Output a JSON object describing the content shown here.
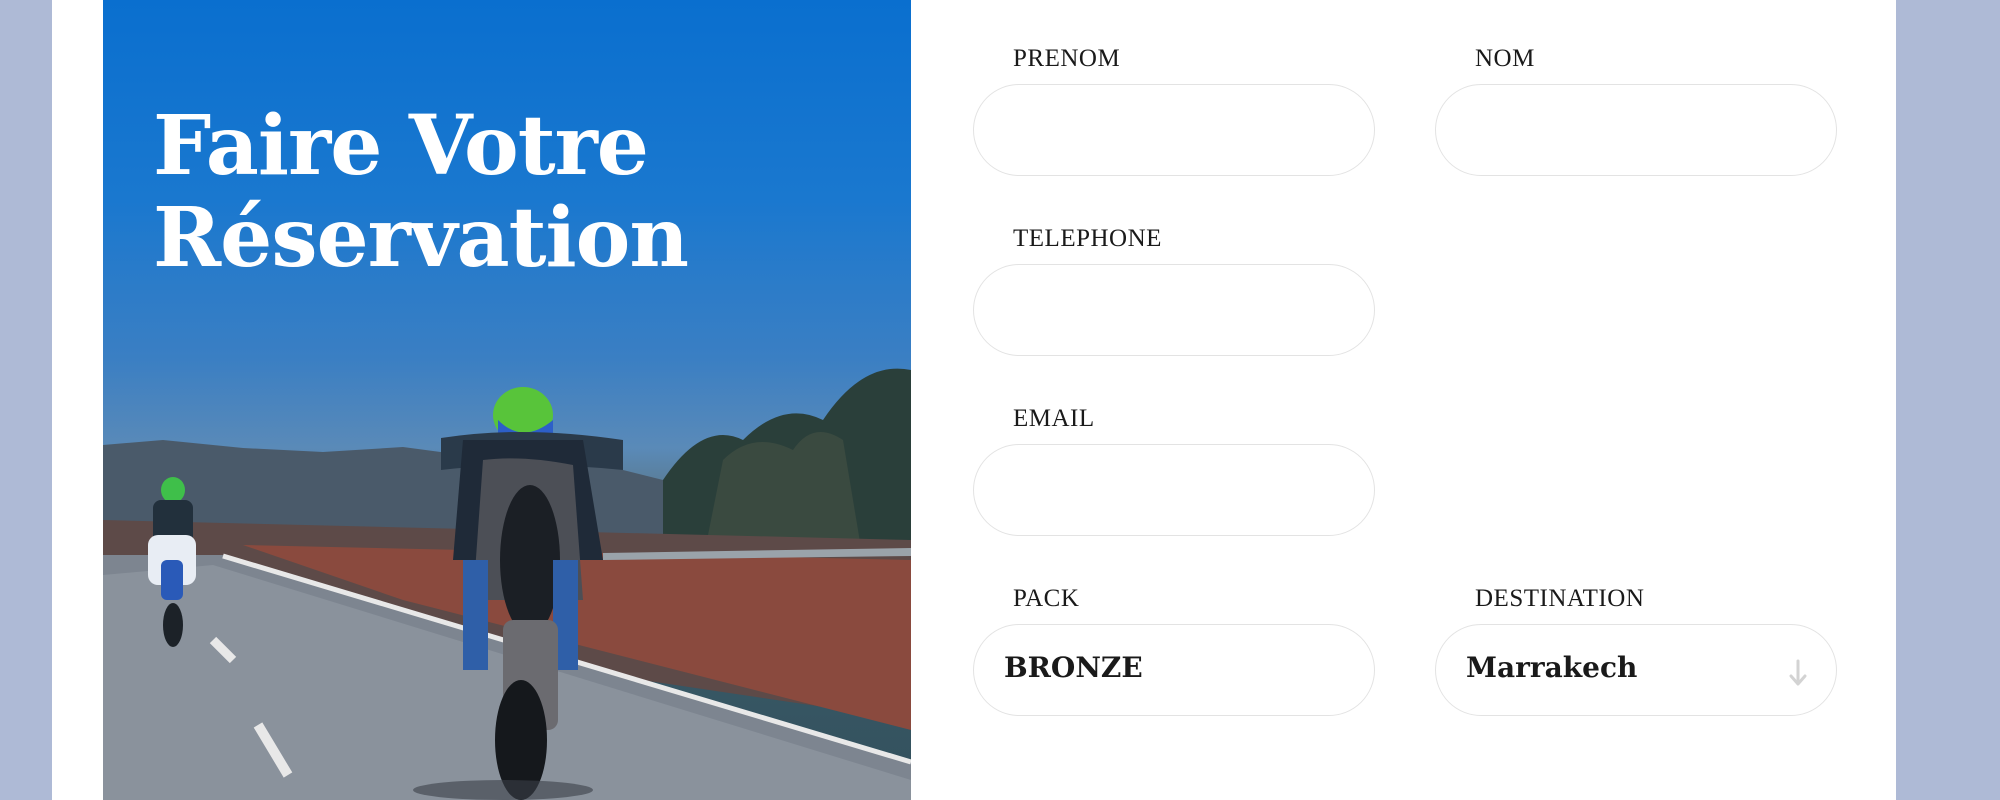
{
  "hero": {
    "title_line1": "Faire Votre",
    "title_line2": "Réservation"
  },
  "form": {
    "prenom_label": "PRENOM",
    "nom_label": "NOM",
    "telephone_label": "TELEPHONE",
    "email_label": "EMAIL",
    "pack_label": "PACK",
    "pack_value": "BRONZE",
    "destination_label": "DESTINATION",
    "destination_value": "Marrakech",
    "destination_icon": "arrow-down-icon"
  },
  "colors": {
    "page_background": "#aebad6",
    "card_background": "#ffffff",
    "field_border": "#e3e3e3"
  }
}
